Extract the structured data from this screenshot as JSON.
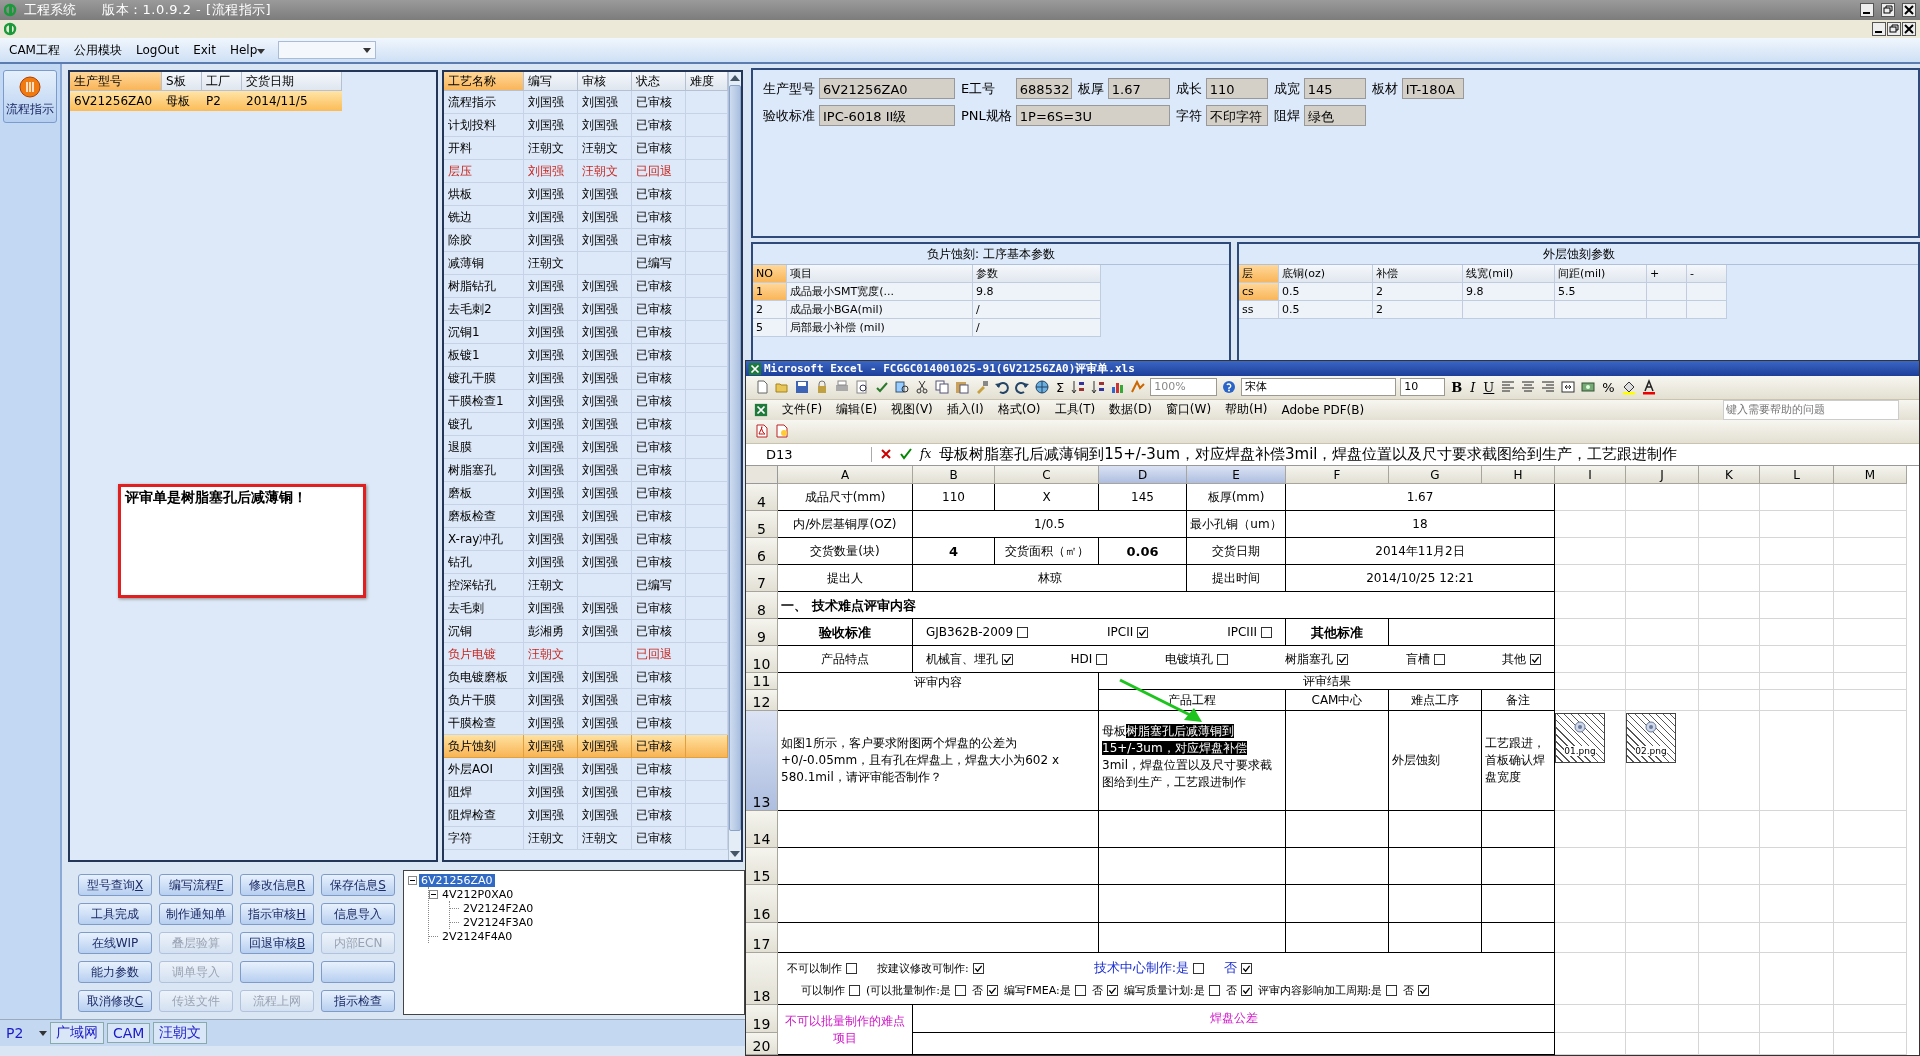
{
  "window": {
    "title": "工程系统",
    "version": "版本：1.0.9.2 - [流程指示]"
  },
  "menu": [
    {
      "label": "CAM工程",
      "has_menu": false
    },
    {
      "label": "公用模块",
      "has_menu": false
    },
    {
      "label": "LogOut",
      "has_menu": false
    },
    {
      "label": "Exit",
      "has_menu": false
    },
    {
      "label": "Help",
      "has_menu": true
    }
  ],
  "nav": [
    {
      "label": "流程指示",
      "selected": true
    }
  ],
  "models": {
    "columns": [
      "生产型号",
      "S板",
      "工厂",
      "交货日期"
    ],
    "rows": [
      {
        "cells": [
          "6V21256ZA0",
          "母板",
          "P2",
          "2014/11/5"
        ],
        "selected": true
      }
    ]
  },
  "note": "评审单是树脂塞孔后减薄铜！",
  "processes": {
    "columns": [
      "工艺名称",
      "编写",
      "审核",
      "状态",
      "难度"
    ],
    "rows": [
      {
        "cells": [
          "流程指示",
          "刘国强",
          "刘国强",
          "已审核"
        ],
        "returned": false,
        "selected": false
      },
      {
        "cells": [
          "计划投料",
          "刘国强",
          "刘国强",
          "已审核"
        ],
        "returned": false,
        "selected": false
      },
      {
        "cells": [
          "开料",
          "汪朝文",
          "汪朝文",
          "已审核"
        ],
        "returned": false,
        "selected": false
      },
      {
        "cells": [
          "层压",
          "刘国强",
          "汪朝文",
          "已回退"
        ],
        "returned": true,
        "selected": false
      },
      {
        "cells": [
          "烘板",
          "刘国强",
          "刘国强",
          "已审核"
        ],
        "returned": false,
        "selected": false
      },
      {
        "cells": [
          "铣边",
          "刘国强",
          "刘国强",
          "已审核"
        ],
        "returned": false,
        "selected": false
      },
      {
        "cells": [
          "除胶",
          "刘国强",
          "刘国强",
          "已审核"
        ],
        "returned": false,
        "selected": false
      },
      {
        "cells": [
          "减薄铜",
          "汪朝文",
          "",
          "已编写"
        ],
        "returned": false,
        "selected": false
      },
      {
        "cells": [
          "树脂钻孔",
          "刘国强",
          "刘国强",
          "已审核"
        ],
        "returned": false,
        "selected": false
      },
      {
        "cells": [
          "去毛刺2",
          "刘国强",
          "刘国强",
          "已审核"
        ],
        "returned": false,
        "selected": false
      },
      {
        "cells": [
          "沉铜1",
          "刘国强",
          "刘国强",
          "已审核"
        ],
        "returned": false,
        "selected": false
      },
      {
        "cells": [
          "板镀1",
          "刘国强",
          "刘国强",
          "已审核"
        ],
        "returned": false,
        "selected": false
      },
      {
        "cells": [
          "镀孔干膜",
          "刘国强",
          "刘国强",
          "已审核"
        ],
        "returned": false,
        "selected": false
      },
      {
        "cells": [
          "干膜检查1",
          "刘国强",
          "刘国强",
          "已审核"
        ],
        "returned": false,
        "selected": false
      },
      {
        "cells": [
          "镀孔",
          "刘国强",
          "刘国强",
          "已审核"
        ],
        "returned": false,
        "selected": false
      },
      {
        "cells": [
          "退膜",
          "刘国强",
          "刘国强",
          "已审核"
        ],
        "returned": false,
        "selected": false
      },
      {
        "cells": [
          "树脂塞孔",
          "刘国强",
          "刘国强",
          "已审核"
        ],
        "returned": false,
        "selected": false
      },
      {
        "cells": [
          "磨板",
          "刘国强",
          "刘国强",
          "已审核"
        ],
        "returned": false,
        "selected": false
      },
      {
        "cells": [
          "磨板检查",
          "刘国强",
          "刘国强",
          "已审核"
        ],
        "returned": false,
        "selected": false
      },
      {
        "cells": [
          "X-ray冲孔",
          "刘国强",
          "刘国强",
          "已审核"
        ],
        "returned": false,
        "selected": false
      },
      {
        "cells": [
          "钻孔",
          "刘国强",
          "刘国强",
          "已审核"
        ],
        "returned": false,
        "selected": false
      },
      {
        "cells": [
          "控深钻孔",
          "汪朝文",
          "",
          "已编写"
        ],
        "returned": false,
        "selected": false
      },
      {
        "cells": [
          "去毛刺",
          "刘国强",
          "刘国强",
          "已审核"
        ],
        "returned": false,
        "selected": false
      },
      {
        "cells": [
          "沉铜",
          "彭湘勇",
          "刘国强",
          "已审核"
        ],
        "returned": false,
        "selected": false
      },
      {
        "cells": [
          "负片电镀",
          "汪朝文",
          "",
          "已回退"
        ],
        "returned": true,
        "selected": false
      },
      {
        "cells": [
          "负电镀磨板",
          "刘国强",
          "刘国强",
          "已审核"
        ],
        "returned": false,
        "selected": false
      },
      {
        "cells": [
          "负片干膜",
          "刘国强",
          "刘国强",
          "已审核"
        ],
        "returned": false,
        "selected": false
      },
      {
        "cells": [
          "干膜检查",
          "刘国强",
          "刘国强",
          "已审核"
        ],
        "returned": false,
        "selected": false
      },
      {
        "cells": [
          "负片蚀刻",
          "刘国强",
          "刘国强",
          "已审核"
        ],
        "returned": false,
        "selected": true
      },
      {
        "cells": [
          "外层AOI",
          "刘国强",
          "刘国强",
          "已审核"
        ],
        "returned": false,
        "selected": false
      },
      {
        "cells": [
          "阻焊",
          "刘国强",
          "刘国强",
          "已审核"
        ],
        "returned": false,
        "selected": false
      },
      {
        "cells": [
          "阻焊检查",
          "刘国强",
          "刘国强",
          "已审核"
        ],
        "returned": false,
        "selected": false
      },
      {
        "cells": [
          "字符",
          "汪朝文",
          "汪朝文",
          "已审核"
        ],
        "returned": false,
        "selected": false
      }
    ]
  },
  "buttons": [
    {
      "label": "型号查询",
      "shortcut": "X",
      "disabled": false
    },
    {
      "label": "编写流程",
      "shortcut": "F",
      "disabled": false
    },
    {
      "label": "修改信息",
      "shortcut": "R",
      "disabled": false
    },
    {
      "label": "保存信息",
      "shortcut": "S",
      "disabled": false
    },
    {
      "label": "工具完成",
      "disabled": false
    },
    {
      "label": "制作通知单",
      "disabled": false
    },
    {
      "label": "指示审核",
      "shortcut": "H",
      "disabled": false
    },
    {
      "label": "信息导入",
      "disabled": false
    },
    {
      "label": "在线WIP",
      "disabled": false
    },
    {
      "label": "叠层验算",
      "disabled": true
    },
    {
      "label": "回退审核",
      "shortcut": "B",
      "disabled": false
    },
    {
      "label": "内部ECN",
      "disabled": true
    },
    {
      "label": "能力参数",
      "disabled": false
    },
    {
      "label": "调单导入",
      "disabled": true
    },
    {
      "disabled": false
    },
    {
      "disabled": false
    },
    {
      "label": "取消修改",
      "shortcut": "C",
      "disabled": false
    },
    {
      "label": "传送文件",
      "disabled": true
    },
    {
      "label": "流程上网",
      "disabled": true
    },
    {
      "label": "指示检查",
      "disabled": false
    }
  ],
  "tree": [
    {
      "label": "6V21256ZA0",
      "selected": true,
      "expanded": true,
      "children": [
        {
          "label": "4V212P0XA0",
          "selected": false,
          "expanded": true,
          "children": [
            {
              "label": "2V2124F2A0",
              "selected": false
            },
            {
              "label": "2V2124F3A0",
              "selected": false
            }
          ]
        },
        {
          "label": "2V2124F4A0",
          "selected": false
        }
      ]
    }
  ],
  "status_bar": {
    "plant": "P2",
    "items": [
      "广域网",
      "CAM",
      "汪朝文"
    ]
  },
  "info": {
    "fields": [
      {
        "label": "生产型号",
        "value": "6V21256ZA0"
      },
      {
        "label": "E工号",
        "value": "688532"
      },
      {
        "label": "板厚",
        "value": "1.67"
      },
      {
        "label": "成长",
        "value": "110"
      },
      {
        "label": "成宽",
        "value": "145"
      },
      {
        "label": "板材",
        "value": "IT-180A"
      },
      {
        "label": "验收标准",
        "value": "IPC-6018 II级"
      },
      {
        "label": "PNL规格",
        "value": "1P=6S=3U"
      },
      {
        "label": "字符",
        "value": "不印字符"
      },
      {
        "label": "阻焊",
        "value": "绿色"
      }
    ]
  },
  "step_params": {
    "title": "负片蚀刻: 工序基本参数",
    "columns": [
      "NO",
      "项目",
      "参数"
    ],
    "rows": [
      {
        "cells": [
          "1",
          "成品最小SMT宽度(...",
          "9.8"
        ],
        "selected": true
      },
      {
        "cells": [
          "2",
          "成品最小BGA(mil)",
          "/"
        ],
        "selected": false
      },
      {
        "cells": [
          "5",
          "局部最小补偿 (mil)",
          "/"
        ],
        "selected": false
      }
    ]
  },
  "etch_params": {
    "title": "外层蚀刻参数",
    "columns": [
      "层",
      "底铜(oz)",
      "补偿",
      "线宽(mil)",
      "间距(mil)",
      "+",
      "-"
    ],
    "rows": [
      {
        "cells": [
          "cs",
          "0.5",
          "2",
          "9.8",
          "5.5"
        ],
        "selected": true
      },
      {
        "cells": [
          "ss",
          "0.5",
          "2"
        ],
        "selected": false
      }
    ]
  },
  "excel": {
    "title": "Microsoft Excel - FCGGC014001025-91(6V21256ZA0)评审单.xls",
    "toolbar": {
      "zoom": "100%",
      "sum": "Σ",
      "font": "宋体",
      "size": "10",
      "bold": "B",
      "italic": "I",
      "underline": "U",
      "percent": "%"
    },
    "menu": [
      "文件(F)",
      "编辑(E)",
      "视图(V)",
      "插入(I)",
      "格式(O)",
      "工具(T)",
      "数据(D)",
      "窗口(W)",
      "帮助(H)",
      "Adobe PDF(B)"
    ],
    "help_placeholder": "键入需要帮助的问题",
    "name_box": "D13",
    "function_label": "fx",
    "formula": "母板树脂塞孔后减薄铜到15+/-3um，对应焊盘补偿3mil，焊盘位置以及尺寸要求截图给到生产，工艺跟进制作",
    "columns": [
      {
        "label": "A",
        "selected": false
      },
      {
        "label": "B",
        "selected": false
      },
      {
        "label": "C",
        "selected": false
      },
      {
        "label": "D",
        "selected": true
      },
      {
        "label": "E",
        "selected": true
      },
      {
        "label": "F",
        "selected": false
      },
      {
        "label": "G",
        "selected": false
      },
      {
        "label": "H",
        "selected": false
      },
      {
        "label": "I",
        "selected": false
      },
      {
        "label": "J",
        "selected": false
      },
      {
        "label": "K",
        "selected": false
      },
      {
        "label": "L",
        "selected": false
      },
      {
        "label": "M",
        "selected": false
      }
    ],
    "rows": [
      {
        "number": "4",
        "selected": false,
        "cells": [
          {
            "text": "成品尺寸(mm)"
          },
          {
            "text": "110"
          },
          {
            "text": "X"
          },
          {
            "text": "145"
          },
          {
            "text": "板厚(mm)"
          },
          {
            "text": "1.67"
          }
        ]
      },
      {
        "number": "5",
        "selected": false,
        "cells": [
          {
            "text": "内/外层基铜厚(OZ)"
          },
          {
            "text": "1/0.5"
          },
          {
            "text": "最小孔铜（um）"
          },
          {
            "text": "18"
          }
        ]
      },
      {
        "number": "6",
        "selected": false,
        "cells": [
          {
            "text": "交货数量(块)"
          },
          {
            "text": "4"
          },
          {
            "text": "交货面积（㎡）"
          },
          {
            "text": "0.06"
          },
          {
            "text": "交货日期"
          },
          {
            "text": "2014年11月2日"
          }
        ]
      },
      {
        "number": "7",
        "selected": false,
        "cells": [
          {
            "text": "提出人"
          },
          {
            "text": "林琼"
          },
          {
            "text": "提出时间"
          },
          {
            "text": "2014/10/25 12:21"
          }
        ]
      },
      {
        "number": "8",
        "selected": false,
        "cells": [
          {
            "text": "一、 技术难点评审内容"
          }
        ]
      },
      {
        "number": "9",
        "selected": false,
        "cells": [
          {
            "text": "验收标准"
          },
          {
            "options": [
              {
                "label": "GJB362B-2009",
                "checked": false
              },
              {
                "label": "IPCII",
                "checked": true
              },
              {
                "label": "IPCIII",
                "checked": false
              }
            ]
          },
          {
            "text": "其他标准"
          },
          {}
        ]
      },
      {
        "number": "10",
        "selected": false,
        "cells": [
          {
            "text": "产品特点"
          },
          {
            "options": [
              {
                "label": "机械盲、埋孔",
                "checked": true
              },
              {
                "label": "HDI",
                "checked": false
              },
              {
                "label": "电镀填孔",
                "checked": false
              },
              {
                "label": "树脂塞孔",
                "checked": true
              },
              {
                "label": "盲槽",
                "checked": false
              },
              {
                "label": "其他",
                "checked": true
              }
            ]
          }
        ]
      },
      {
        "number": "11",
        "selected": false,
        "cells": [
          {
            "text": "评审内容"
          },
          {
            "text": "评审结果"
          }
        ]
      },
      {
        "number": "12",
        "selected": false,
        "cells": [
          {},
          {
            "text": "产品工程"
          },
          {
            "text": "CAM中心"
          },
          {
            "text": "难点工序"
          },
          {
            "text": "备注"
          }
        ]
      },
      {
        "number": "13",
        "selected": true,
        "cells": [
          {
            "text": "如图1所示，客户要求附图两个焊盘的公差为+0/-0.05mm，且有孔在焊盘上，焊盘大小为602 x 580.1mil，请评审能否制作？"
          },
          {
            "parts": [
              {
                "text": "母板",
                "selected": false
              },
              {
                "text": "树脂塞孔后减薄铜到15+/-3um，对应焊盘补偿",
                "selected": true
              },
              {
                "text": "3mil，焊盘位置以及尺寸要求截图给到生产，工艺跟进制作",
                "selected": false
              }
            ]
          },
          {},
          {
            "text": "外层蚀刻"
          },
          {
            "text": "工艺跟进，首板确认焊盘宽度"
          }
        ]
      },
      {
        "number": "14",
        "selected": false,
        "cells": [
          {},
          {},
          {},
          {},
          {}
        ]
      },
      {
        "number": "15",
        "selected": false,
        "cells": [
          {},
          {},
          {},
          {},
          {}
        ]
      },
      {
        "number": "16",
        "selected": false,
        "cells": [
          {},
          {},
          {},
          {},
          {}
        ]
      },
      {
        "number": "17",
        "selected": false,
        "cells": [
          {},
          {},
          {},
          {},
          {}
        ]
      },
      {
        "number": "18",
        "selected": false,
        "cells": [
          {
            "lines": [
              [
                {
                  "label": "不可以制作",
                  "checked": false,
                  "highlighted": false
                },
                {
                  "label": "按建议修改可制作:",
                  "checked": true,
                  "highlighted": false
                },
                {
                  "label": "技术中心制作:是",
                  "checked": false,
                  "highlighted": true
                },
                {
                  "label": "否",
                  "checked": true,
                  "highlighted": true
                }
              ],
              [
                {
                  "label": "可以制作",
                  "checked": false,
                  "highlighted": false
                },
                {
                  "label": "(可以批量制作:是",
                  "checked": false,
                  "highlighted": false
                },
                {
                  "label": "否",
                  "checked": true,
                  "highlighted": false
                },
                {
                  "label": "编写FMEA:是",
                  "checked": false,
                  "highlighted": false
                },
                {
                  "label": "否",
                  "checked": true,
                  "highlighted": false
                },
                {
                  "label": "编写质量计划:是",
                  "checked": false,
                  "highlighted": false
                },
                {
                  "label": "否",
                  "checked": true,
                  "highlighted": false
                },
                {
                  "label": "评审内容影响加工周期:是",
                  "checked": false,
                  "highlighted": false
                },
                {
                  "label": "否",
                  "checked": true,
                  "highlighted": false
                }
              ]
            ]
          }
        ]
      },
      {
        "number": "19",
        "selected": false,
        "cells": [
          {
            "text": "不可以批量制作的难点项目"
          },
          {
            "text": "焊盘公差"
          }
        ]
      },
      {
        "number": "20",
        "selected": false,
        "cells": [
          {},
          {}
        ]
      }
    ],
    "images": [
      {
        "label": "01.png"
      },
      {
        "label": "02.png"
      }
    ]
  }
}
